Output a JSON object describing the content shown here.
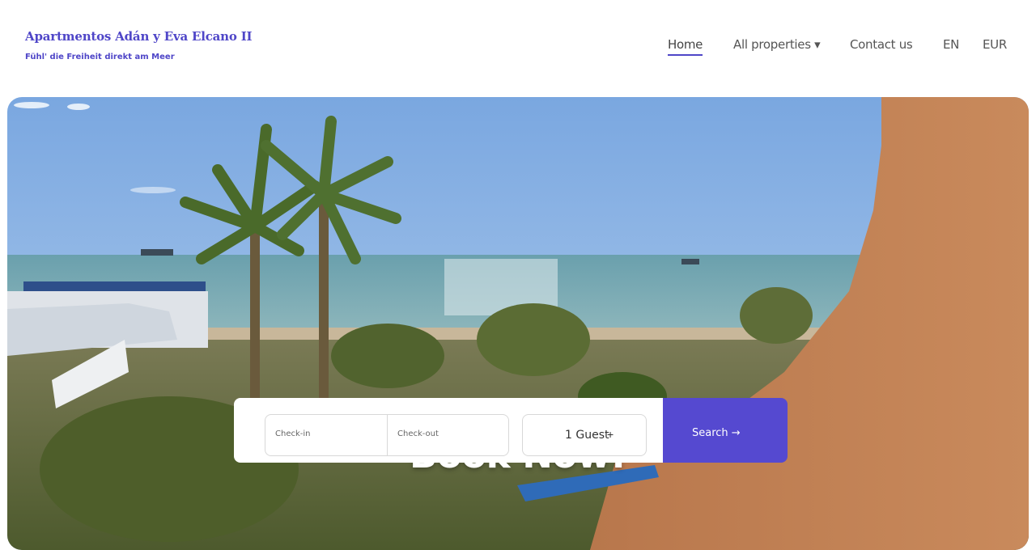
{
  "brand": {
    "title": "Apartmentos Adán y Eva Elcano II",
    "tagline": "Fühl' die Freiheit direkt am Meer"
  },
  "nav": {
    "items": [
      {
        "label": "Home",
        "active": true
      },
      {
        "label": "All properties ▾",
        "active": false
      },
      {
        "label": "Contact us",
        "active": false
      },
      {
        "label": "EN",
        "active": false
      },
      {
        "label": "EUR",
        "active": false
      }
    ]
  },
  "hero": {
    "heading": "Book Now!",
    "image": "beach-with-palm-trees-photo"
  },
  "booking": {
    "check_in_label": "Check-in",
    "check_out_label": "Check-out",
    "guests_value": "1 Guest",
    "plus_symbol": "+",
    "search_label": "Search →"
  },
  "colors": {
    "accent": "#4f46c8",
    "button": "#5549d0"
  }
}
